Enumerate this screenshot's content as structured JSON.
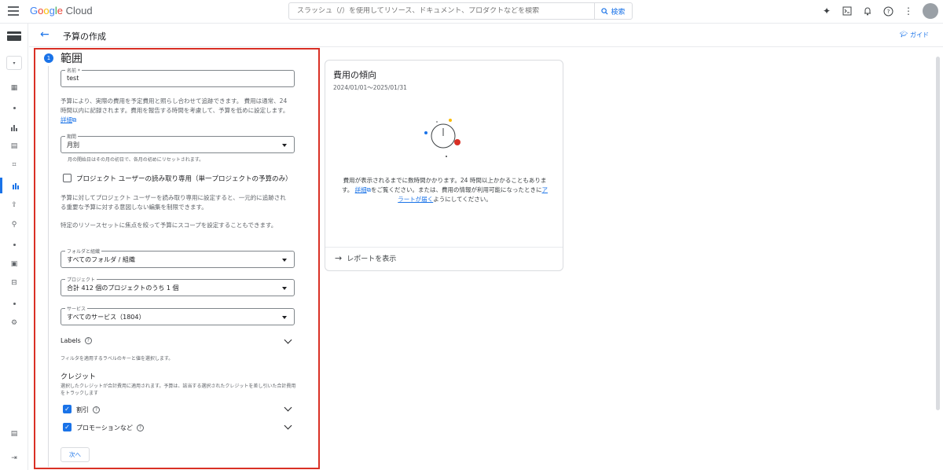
{
  "app": {
    "logo_text": "Google Cloud"
  },
  "search": {
    "placeholder": "スラッシュ（/）を使用してリソース、ドキュメント、プロダクトなどを検索",
    "button_label": "検索"
  },
  "header": {
    "title": "予算の作成",
    "guide_label": "ガイド"
  },
  "step": {
    "number": "1",
    "title": "範囲"
  },
  "form": {
    "name_label": "名前 *",
    "name_value": "test",
    "intro_text": "予算により、実際の費用を予定費用と照らし合わせて追跡できます。 費用は通常、24 時間以内に記録されます。費用を報告する時間を考慮して、予算を低めに設定します。",
    "intro_link": "詳細",
    "period_label": "期間",
    "period_value": "月別",
    "period_hint": "月の開始日はその月の初日で、各月の初めにリセットされます。",
    "readonly_checkbox_label": "プロジェクト ユーザーの読み取り専用（単一プロジェクトの予算のみ）",
    "readonly_help": "予算に対してプロジェクト ユーザーを読み取り専用に設定すると、一元的に追跡される重要な予算に対する意図しない編集を制限できます。",
    "scope_help": "特定のリソースセットに焦点を絞って予算にスコープを設定することもできます。",
    "folders_label": "フォルダと組織",
    "folders_value": "すべてのフォルダ / 組織",
    "projects_label": "プロジェクト",
    "projects_value": "合計 412 個のプロジェクトのうち 1 個",
    "services_label": "サービス",
    "services_value": "すべてのサービス（1804）",
    "labels_title": "Labels",
    "labels_help": "フィルタを適用するラベルのキーと値を選択します。",
    "credits_title": "クレジット",
    "credits_help": "選択したクレジットが合計費用に適用されます。予算は、該当する選択されたクレジットを差し引いた合計費用をトラックします",
    "discount_label": "割引",
    "promotion_label": "プロモーションなど",
    "next_label": "次へ"
  },
  "cost_card": {
    "title": "費用の傾向",
    "range": "2024/01/01～2025/01/31",
    "message_1": "費用が表示されるまでに数時間かかります。24 時間以上かかることもあります。",
    "link_1": "詳細",
    "message_2": "をご覧ください。または、費用の情報が利用可能になったときに",
    "link_2": "アラートが届く",
    "message_3": "ようにしてください。",
    "report_label": "レポートを表示"
  },
  "colors": {
    "accent": "#1a73e8",
    "highlight": "#d93025"
  }
}
